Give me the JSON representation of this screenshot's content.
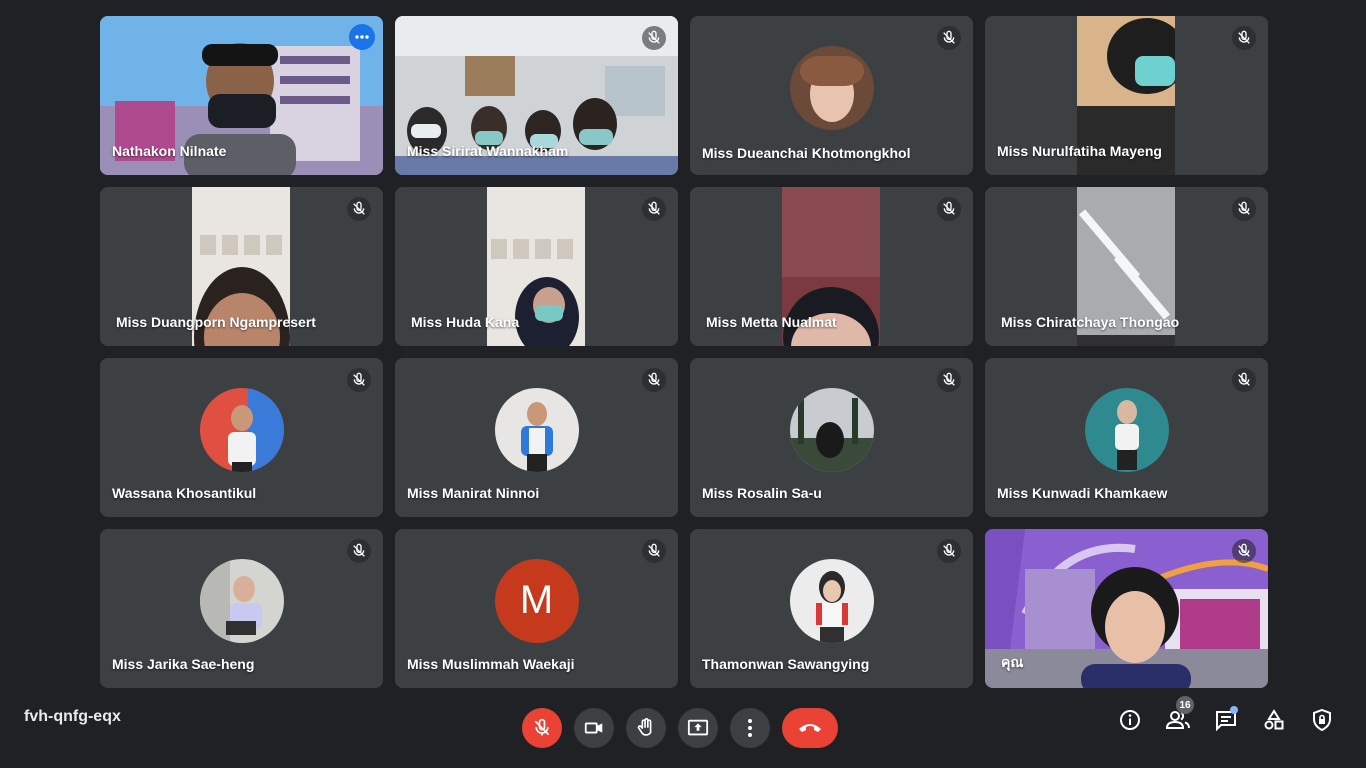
{
  "meeting": {
    "code": "fvh-qnfg-eqx",
    "participant_count": "16"
  },
  "participants": [
    {
      "name": "Nathakon Nilnate"
    },
    {
      "name": "Miss Sirirat Wannakham"
    },
    {
      "name": "Miss Dueanchai Khotmongkhol"
    },
    {
      "name": "Miss Nurulfatiha Mayeng"
    },
    {
      "name": "Miss Duangporn Ngampresert"
    },
    {
      "name": "Miss Huda Kana"
    },
    {
      "name": "Miss Metta Nualmat"
    },
    {
      "name": "Miss Chiratchaya Thongao"
    },
    {
      "name": "Wassana Khosantikul"
    },
    {
      "name": "Miss Manirat Ninnoi"
    },
    {
      "name": "Miss Rosalin Sa-u"
    },
    {
      "name": "Miss Kunwadi Khamkaew"
    },
    {
      "name": "Miss Jarika Sae-heng"
    },
    {
      "name": "Miss Muslimmah Waekaji",
      "avatar_letter": "M"
    },
    {
      "name": "Thamonwan Sawangying"
    },
    {
      "name": "คุณ"
    }
  ],
  "colors": {
    "background": "#202124",
    "tile": "#3c4043",
    "danger": "#ea4335",
    "accent": "#1a73e8",
    "active_border": "#8ab4f8",
    "letter_avatar": "#c5391c"
  },
  "icons": {
    "mic_off": "mic-off-icon",
    "camera": "camera-icon",
    "raise_hand": "raise-hand-icon",
    "present": "present-screen-icon",
    "more": "more-options-icon",
    "hangup": "hang-up-icon",
    "info": "info-icon",
    "people": "people-icon",
    "chat": "chat-icon",
    "activities": "activities-icon",
    "host_controls": "host-controls-icon"
  }
}
